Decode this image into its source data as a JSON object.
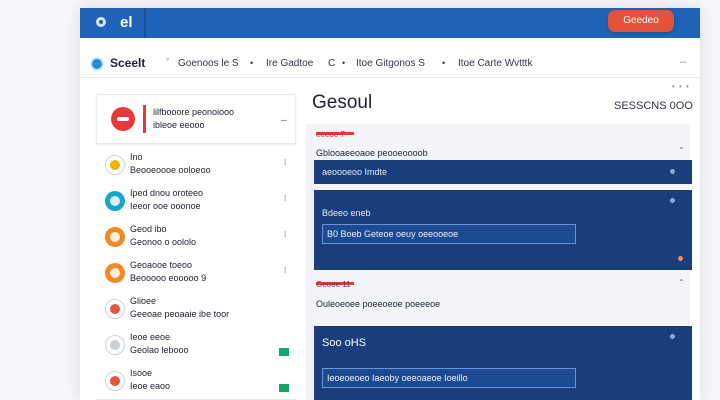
{
  "topbar": {
    "title": "el",
    "action_label": "Geedeo"
  },
  "nav": {
    "brand": "Sceelt",
    "items": [
      "Goenoos le S",
      "Ire Gadtoe",
      "Itoe Gitgonos S",
      "Itoe Carte Wvtttk"
    ],
    "arrows": [
      "C",
      "C"
    ],
    "minus": "–"
  },
  "menu_dots": "• • •",
  "profile": {
    "name": "lilfbooore peonoiooo",
    "sub": "ibleoe eeooo",
    "dash": "–"
  },
  "list": [
    {
      "title": "Ino",
      "sub": "Beooeoooe ooloeoo",
      "icon": "circle-icon",
      "color": "#f0b400",
      "filled": false,
      "mark": "I",
      "checked": false
    },
    {
      "title": "Iped dnou oroteeo",
      "sub": "Ieeor ooe ooonoe",
      "icon": "chat-icon",
      "color": "#17a8c8",
      "filled": true,
      "mark": "I",
      "checked": false
    },
    {
      "title": "Geod ibo",
      "sub": "Geonoo o oololo",
      "icon": "user-icon",
      "color": "#f08a22",
      "filled": true,
      "mark": "I",
      "checked": false
    },
    {
      "title": "Geoaooe toeoo",
      "sub": "Beooooo eooooo 9",
      "icon": "bell-icon",
      "color": "#f08a22",
      "filled": true,
      "mark": "I",
      "checked": false
    },
    {
      "title": "Glioee",
      "sub": "Geeoae peoaaie ibe toor",
      "icon": "circle-icon",
      "color": "#e3563c",
      "filled": false,
      "mark": "",
      "checked": false
    },
    {
      "title": "Ieoe eeoe",
      "sub": "Geolao lebooo",
      "icon": "circle-icon",
      "color": "#c8cdd6",
      "filled": false,
      "mark": "",
      "checked": true
    },
    {
      "title": "Isooe",
      "sub": "Ieoe eaoo",
      "icon": "circle-icon",
      "color": "#e3563c",
      "filled": false,
      "mark": "",
      "checked": true
    }
  ],
  "main": {
    "title": "Gesoul",
    "total": "SESSCNS 0OO",
    "panel1": {
      "tag": "eeeoe 7",
      "head": "Gblooaeeoaoe peooeoooob",
      "rows": [
        "aeoooeoo Imdte",
        "Bdeeo eneb",
        "B0 Boeb Geteoe oeuy oeeooeoe"
      ]
    },
    "panel2": {
      "tag": "Geooe 11",
      "head": "Ouleoeoee poeeoeoe poeeeoe",
      "big": "Soo oHS",
      "input": "Ieoeoeoeo Iaeoby oeeoaeoe Ioeillo"
    }
  },
  "colors": {
    "brand_blue": "#1f63b8",
    "accent_red": "#e2533a",
    "card_blue": "#183f7c"
  }
}
